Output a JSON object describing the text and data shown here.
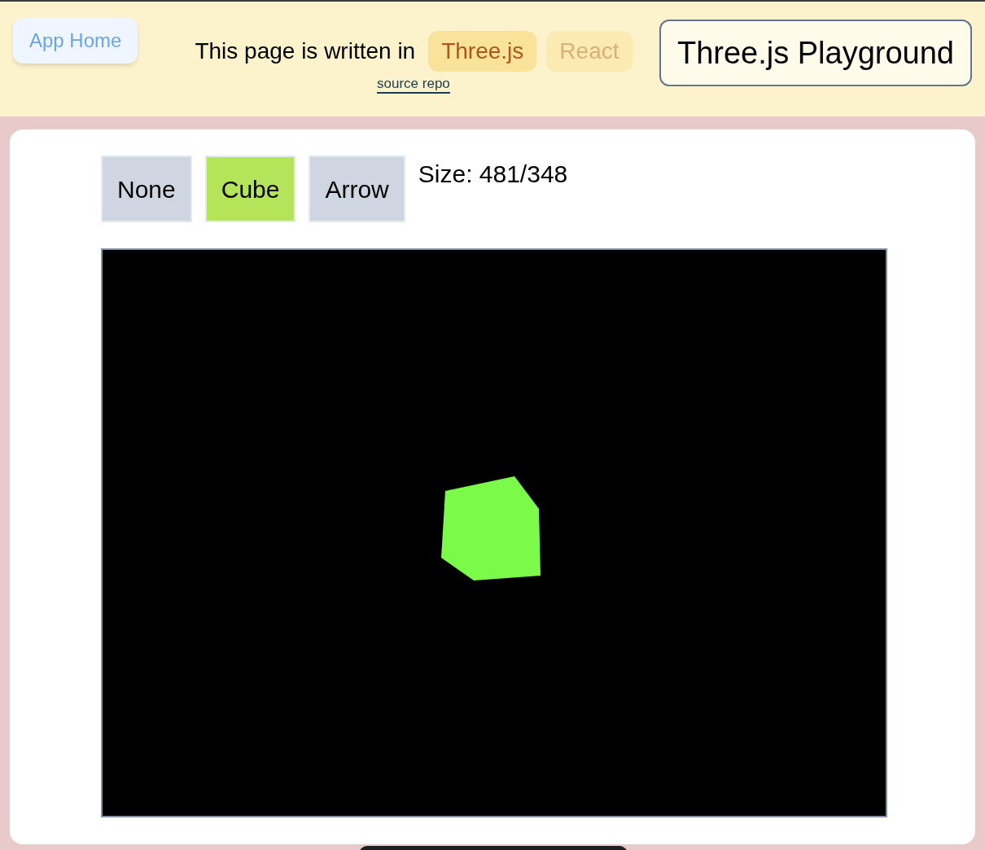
{
  "header": {
    "home_button": "App Home",
    "intro": "This page is written in",
    "tags": [
      {
        "label": "Three.js",
        "selected": true
      },
      {
        "label": "React",
        "selected": false
      }
    ],
    "source_link": "source repo",
    "title": "Three.js Playground"
  },
  "controls": {
    "buttons": [
      {
        "label": "None",
        "selected": false
      },
      {
        "label": "Cube",
        "selected": true
      },
      {
        "label": "Arrow",
        "selected": false
      }
    ],
    "size": "Size: 481/348"
  }
}
